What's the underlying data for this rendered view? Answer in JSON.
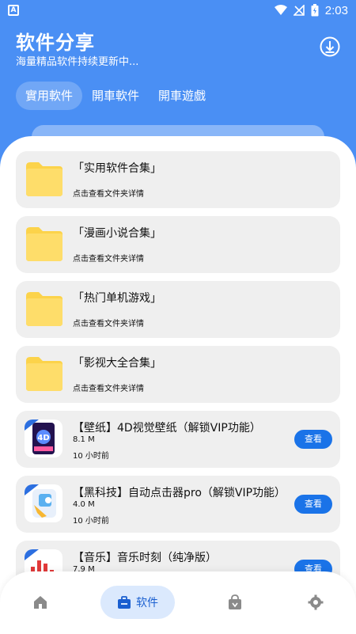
{
  "status_bar": {
    "time": "2:03",
    "left_icon": "app-notification-icon",
    "icons": [
      "wifi-icon",
      "no-signal-icon",
      "battery-icon"
    ]
  },
  "header": {
    "title": "软件分享",
    "subtitle": "海量精品软件持续更新中...",
    "download_icon": "download-icon"
  },
  "tabs": [
    {
      "label": "實用軟件",
      "active": true
    },
    {
      "label": "開車軟件",
      "active": false
    },
    {
      "label": "開車遊戲",
      "active": false
    }
  ],
  "folders": [
    {
      "title": "「实用软件合集」",
      "subtitle": "点击查看文件夹详情"
    },
    {
      "title": "「漫画小说合集」",
      "subtitle": "点击查看文件夹详情"
    },
    {
      "title": "「热门单机游戏」",
      "subtitle": "点击查看文件夹详情"
    },
    {
      "title": "「影视大全合集」",
      "subtitle": "点击查看文件夹详情"
    }
  ],
  "apps": [
    {
      "title": "【壁纸】4D视觉壁纸（解锁VIP功能）",
      "size": "8.1 M",
      "time": "10 小时前",
      "button": "查看",
      "icon": "wallpaper-app-icon"
    },
    {
      "title": "【黑科技】自动点击器pro（解锁VIP功能）",
      "size": "4.0 M",
      "time": "10 小时前",
      "button": "查看",
      "icon": "auto-clicker-app-icon"
    },
    {
      "title": "【音乐】音乐时刻（纯净版）",
      "size": "7.9 M",
      "time": "",
      "button": "查看",
      "icon": "music-app-icon"
    }
  ],
  "bottom_nav": [
    {
      "label": "",
      "icon": "home-icon",
      "active": false
    },
    {
      "label": "软件",
      "icon": "toolbox-icon",
      "active": true
    },
    {
      "label": "",
      "icon": "bag-icon",
      "active": false
    },
    {
      "label": "",
      "icon": "settings-icon",
      "active": false
    }
  ],
  "colors": {
    "primary": "#4a8ff4",
    "button": "#1a73e8",
    "folder": "#fedd6a",
    "card": "#efefef"
  }
}
